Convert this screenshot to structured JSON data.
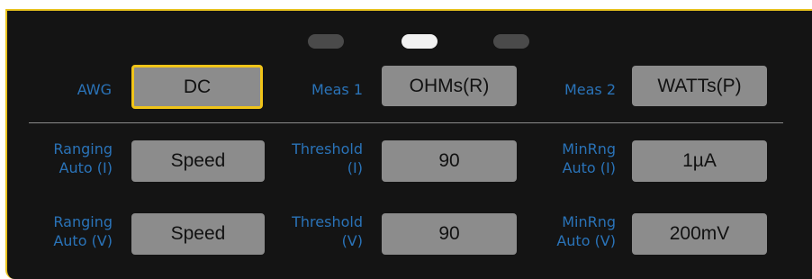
{
  "pager": {
    "pages": 3,
    "active_index": 1
  },
  "top_row": {
    "awg_label": "AWG",
    "awg_value": "DC",
    "meas1_label": "Meas 1",
    "meas1_value": "OHMs(R)",
    "meas2_label": "Meas 2",
    "meas2_value": "WATTs(P)"
  },
  "current_row": {
    "ranging_label": "Ranging\nAuto (I)",
    "ranging_value": "Speed",
    "threshold_label": "Threshold\n(I)",
    "threshold_value": "90",
    "minrng_label": "MinRng\nAuto (I)",
    "minrng_value": "1µA"
  },
  "voltage_row": {
    "ranging_label": "Ranging\nAuto (V)",
    "ranging_value": "Speed",
    "threshold_label": "Threshold\n(V)",
    "threshold_value": "90",
    "minrng_label": "MinRng\nAuto (V)",
    "minrng_value": "200mV"
  },
  "colors": {
    "label_blue": "#2a73b8",
    "accent_yellow": "#f0c419",
    "button_gray": "#8c8c8c",
    "panel_bg": "#141414"
  }
}
